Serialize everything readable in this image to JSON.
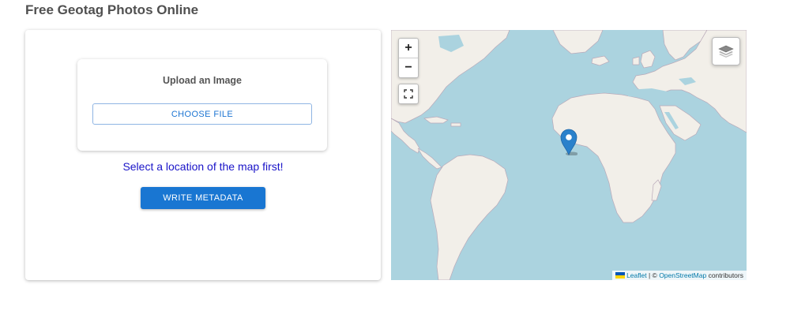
{
  "page": {
    "title": "Free Geotag Photos Online"
  },
  "upload": {
    "title": "Upload an Image",
    "choose_file_label": "CHOOSE FILE"
  },
  "notice": {
    "text": "Select a location of the map first!",
    "color": "#1a14c8"
  },
  "write_button": {
    "label": "WRITE METADATA",
    "color": "#1976d2"
  },
  "map": {
    "zoom_in_label": "+",
    "zoom_out_label": "−",
    "fullscreen_icon": "fullscreen-icon",
    "layers_icon": "layers-icon",
    "marker_icon": "map-pin-icon",
    "attribution": {
      "leaflet": "Leaflet",
      "separator": "| ©",
      "osm": "OpenStreetMap",
      "suffix": "contributors"
    },
    "water_color": "#abd3df",
    "land_color": "#f2efe9",
    "marker_color": "#2a81cb"
  }
}
